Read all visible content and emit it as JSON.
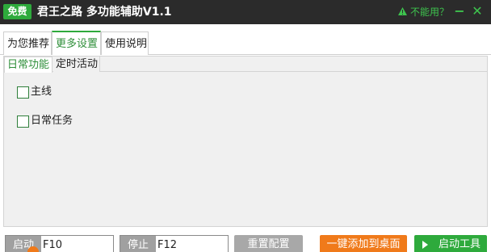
{
  "titlebar": {
    "badge": "免费",
    "title": "君王之路 多功能辅助V1.1",
    "help_link": "不能用？",
    "minimize": "−",
    "close": "✕"
  },
  "main_tabs": [
    {
      "label": "为您推荐"
    },
    {
      "label": "更多设置"
    },
    {
      "label": "使用说明"
    }
  ],
  "sub_tabs": [
    {
      "label": "日常功能"
    },
    {
      "label": "定时活动"
    }
  ],
  "options": [
    {
      "label": "主线",
      "checked": false
    },
    {
      "label": "日常任务",
      "checked": false
    }
  ],
  "bottom": {
    "start_hotkey": {
      "label": "启动",
      "value": "F10"
    },
    "stop_hotkey": {
      "label": "停止",
      "value": "F12"
    },
    "reset_button": "重置配置",
    "desktop_button": "一键添加到桌面",
    "start_tool_button": "启动工具"
  },
  "colors": {
    "accent_green": "#2eaa3c",
    "titlebar_bg": "#2b2b2b",
    "orange": "#f07a1a",
    "gray_button": "#a8a8a8"
  }
}
